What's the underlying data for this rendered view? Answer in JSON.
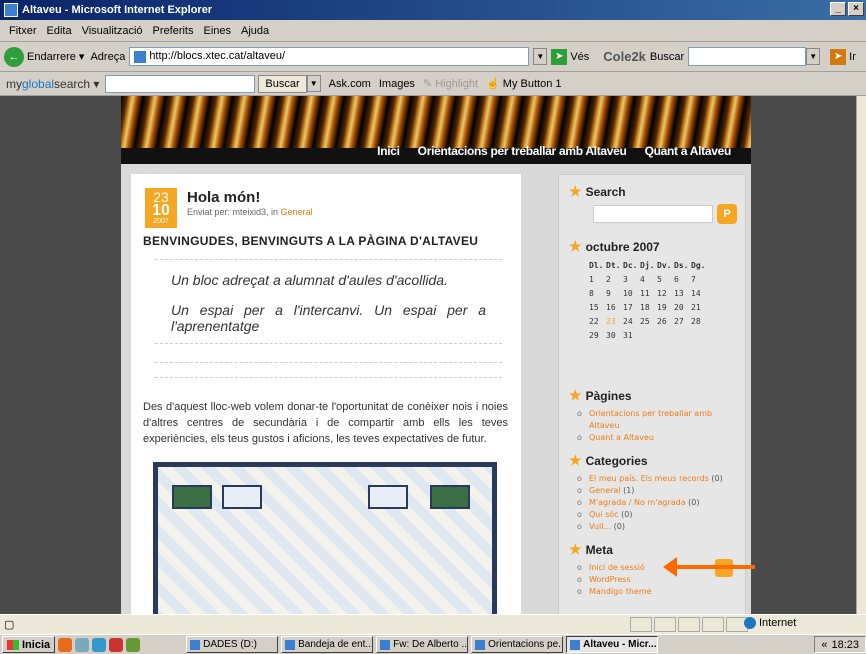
{
  "window": {
    "title": "Altaveu - Microsoft Internet Explorer",
    "controls": [
      "_",
      "×"
    ]
  },
  "menu": [
    "Fitxer",
    "Edita",
    "Visualització",
    "Preferits",
    "Eines",
    "Ajuda"
  ],
  "toolbar": {
    "back_label": "Endarrere",
    "address_label": "Adreça",
    "address_value": "http://blocs.xtec.cat/altaveu/",
    "go_label": "Vés",
    "cole2k_brand": "Cole2k",
    "cole2k_search_label": "Buscar",
    "ir_label": "Ir"
  },
  "toolbar2": {
    "brand_pre": "my",
    "brand_mid": "global",
    "brand_post": "search",
    "buscar_label": "Buscar",
    "ask_label": "Ask.com",
    "images_label": "Images",
    "highlight_label": "Highlight",
    "mybutton_label": "My Button 1"
  },
  "blog": {
    "nav": [
      "Inici",
      "Orientacions per treballar amb Altaveu",
      "Quant a Altaveu"
    ],
    "post": {
      "day": "23",
      "month": "10",
      "year": "2007",
      "title": "Hola món!",
      "meta_prefix": "Enviat per: mteixid3, in",
      "meta_category": "General",
      "heading": "BENVINGUDES, BENVINGUTS A LA PÀGINA D'ALTAVEU",
      "quote_1": "Un bloc adreçat a alumnat d'aules d'acollida.",
      "quote_2": "Un espai per a l'intercanvi. Un espai per a l'aprenentatge",
      "body": "Des d'aquest lloc-web volem donar-te l'oportunitat de conèixer nois i noies d'altres centres de secundària i de compartir amb ells les teves experiències, els teus gustos i aficions, les teves expectatives de futur."
    },
    "sidebar": {
      "search_title": "Search",
      "calendar_title": "octubre 2007",
      "calendar_header": [
        "Dl.",
        "Dt.",
        "Dc.",
        "Dj.",
        "Dv.",
        "Ds.",
        "Dg."
      ],
      "calendar_rows": [
        [
          "1",
          "2",
          "3",
          "4",
          "5",
          "6",
          "7"
        ],
        [
          "8",
          "9",
          "10",
          "11",
          "12",
          "13",
          "14"
        ],
        [
          "15",
          "16",
          "17",
          "18",
          "19",
          "20",
          "21"
        ],
        [
          "22",
          "23",
          "24",
          "25",
          "26",
          "27",
          "28"
        ],
        [
          "29",
          "30",
          "31",
          "",
          "",
          "",
          ""
        ]
      ],
      "pages_title": "Pàgines",
      "pages": [
        "Orientacions per treballar amb Altaveu",
        "Quant a Altaveu"
      ],
      "categories_title": "Categories",
      "categories": [
        {
          "label": "El meu país. Els meus records",
          "count": "(0)"
        },
        {
          "label": "General",
          "count": "(1)"
        },
        {
          "label": "M'agrada / No m'agrada",
          "count": "(0)"
        },
        {
          "label": "Qui sóc",
          "count": "(0)"
        },
        {
          "label": "Vull...",
          "count": "(0)"
        }
      ],
      "meta_title": "Meta",
      "meta_links": [
        "Inici de sessió",
        "WordPress",
        "Mandigo theme"
      ]
    }
  },
  "status": {
    "zone": "Internet"
  },
  "taskbar": {
    "start": "Inicia",
    "tasks": [
      "DADES (D:)",
      "Bandeja de ent...",
      "Fw: De Alberto ...",
      "Orientacions pe...",
      "Altaveu - Micr..."
    ],
    "time": "18:23"
  },
  "colors": {
    "accent": "#f5a623",
    "link": "#f07c1a",
    "arrow": "#ff6a00"
  }
}
